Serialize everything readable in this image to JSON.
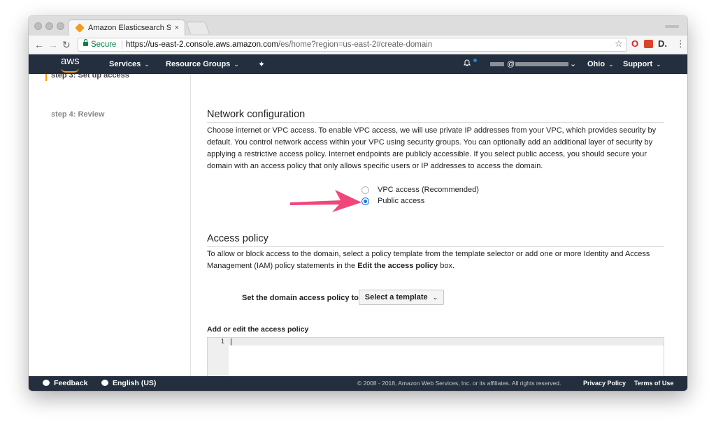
{
  "browser": {
    "tab_title": "Amazon Elasticsearch Service",
    "tab_close": "×",
    "secure_label": "Secure",
    "url_scheme_host": "https://us-east-2.console.aws.amazon.com",
    "url_path": "/es/home?region=us-east-2#create-domain"
  },
  "awsnav": {
    "logo": "aws",
    "services": "Services",
    "resource_groups": "Resource Groups",
    "account_at": "@",
    "region": "Ohio",
    "support": "Support",
    "caret": "⌄"
  },
  "sidebar": {
    "steps": [
      {
        "label": "step 3: Set up access"
      },
      {
        "label": "step 4: Review"
      }
    ]
  },
  "network": {
    "title": "Network configuration",
    "description": "Choose internet or VPC access. To enable VPC access, we will use private IP addresses from your VPC, which provides security by default. You control network access within your VPC using security groups. You can optionally add an additional layer of security by applying a restrictive access policy. Internet endpoints are publicly accessible. If you select public access, you should secure your domain with an access policy that only allows specific users or IP addresses to access the domain.",
    "options": [
      {
        "label": "VPC access (Recommended)",
        "selected": false
      },
      {
        "label": "Public access",
        "selected": true
      }
    ]
  },
  "access_policy": {
    "title": "Access policy",
    "description_pre": "To allow or block access to the domain, select a policy template from the template selector or add one or more Identity and Access Management (IAM) policy statements in the ",
    "description_bold": "Edit the access policy",
    "description_post": " box.",
    "set_label": "Set the domain access policy to",
    "select_label": "Select a template",
    "editor_label": "Add or edit the access policy",
    "line_number": "1"
  },
  "footer": {
    "feedback": "Feedback",
    "language": "English (US)",
    "copyright": "© 2008 - 2018, Amazon Web Services, Inc. or its affiliates. All rights reserved.",
    "privacy": "Privacy Policy",
    "terms": "Terms of Use"
  },
  "colors": {
    "aws_nav": "#232f3e",
    "aws_orange": "#ff9900",
    "radio_blue": "#1a73e8",
    "annotation_arrow": "#f2457a"
  }
}
